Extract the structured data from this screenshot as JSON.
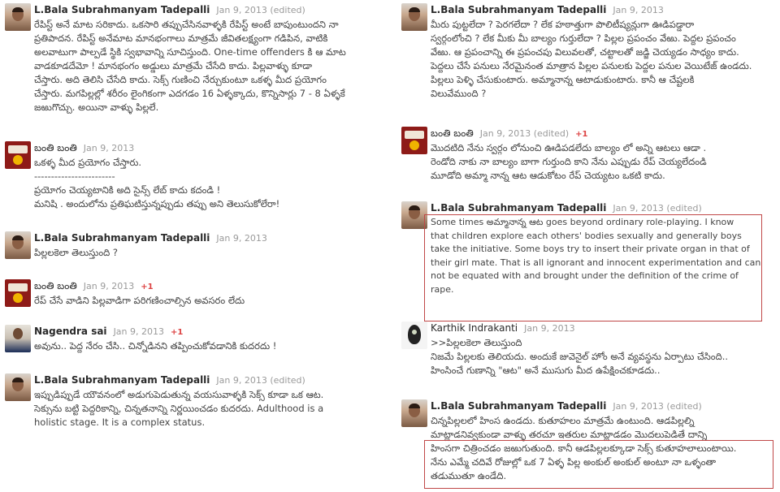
{
  "left": [
    {
      "author": "L.Bala Subrahmanyam Tadepalli",
      "date": "Jan 9, 2013 (edited)",
      "plus": "",
      "avatar": "bala",
      "lines": [
        "రేపిస్ట్ అనే మాట సరికాదు. ఒకసారి తప్పుచేసినవాళ్ళకి రేపిస్ట్ అంటే బాపుంటుందని నా",
        "ప్రతిపాదన. రేపిస్ట్ అనేమాట మానభంగాలు మాత్రమే జీవితలక్ష్యంగా గడిపిన, వాటికి",
        "అలవాటుగా పాల్పడే స్థికి స్వభావాన్ని సూచిస్తుంది. One-time offenders కి ఆ మాట",
        "వాడకూడదేమో ! మానభంగం అడ్డులు మాత్రమే చేసేది కాదు. పిల్లవాళ్ళు కూడా",
        "చేస్తారు. అది తెలిసి చేసేది కాదు. సెక్స్ గుణించి నేర్చుకుంటూ ఒకళ్ళ మీద ప్రయోగం",
        "చేస్తారు. మగపిల్లల్లో శరీరం లైంగికంగా ఎదగడం 16 ఏళ్ళక్కాదు, కొన్నిసార్లు 7 - 8 ఏళ్ళకే",
        "జఱుగొచ్చు. అయినా వాళ్ళు పిల్లలే."
      ]
    },
    {
      "author": "బంతి బంతి",
      "date": "Jan 9, 2013",
      "plus": "",
      "avatar": "banti",
      "lines": [
        "ఒకళ్ళ మీద ప్రయోగం చేస్తారు.",
        "------------------------",
        "ప్రయోగం చెయ్యటానికి అది సైన్స్ లేబ్ కాదు కదండి !",
        "మనిషి . అందులోను ప్రతిఘటిస్తున్నప్పుడు తప్పు అని తెలుసుకోలేరా!"
      ]
    },
    {
      "author": "L.Bala Subrahmanyam Tadepalli",
      "date": "Jan 9, 2013",
      "plus": "",
      "avatar": "bala",
      "lines": [
        "పిల్లలకెలా తెలుస్తుంది ?"
      ]
    },
    {
      "author": "బంతి బంతి",
      "date": "Jan 9, 2013",
      "plus": "+1",
      "avatar": "banti",
      "lines": [
        "రేప్ చేసే వాడిని పిల్లవాడిగా పరిగణించాల్సిన అవసరం లేదు"
      ]
    },
    {
      "author": "Nagendra sai",
      "date": "Jan 9, 2013",
      "plus": "+1",
      "avatar": "nag",
      "lines": [
        "అవును.. పెద్ద నేరం చేసి.. చిన్నోడినని తప్పించుకోవడానికి కుదరదు !"
      ]
    },
    {
      "author": "L.Bala Subrahmanyam Tadepalli",
      "date": "Jan 9, 2013 (edited)",
      "plus": "",
      "avatar": "bala",
      "lines": [
        "ఇప్పుడిప్పుడే యౌవనంలో అడుగుపెడుతున్న వయసువాళ్ళకి సెక్స్ కూడా ఒక ఆట.",
        "సెక్సును బట్టి పెద్దరికాన్ని, చిన్నతనాన్ని నిర్ణయించడం కుదరదు. Adulthood is a",
        "holistic stage. It is a complex status."
      ]
    }
  ],
  "right": [
    {
      "author": "L.Bala Subrahmanyam Tadepalli",
      "date": "Jan 9, 2013",
      "plus": "",
      "avatar": "bala",
      "lines": [
        "మీరు పుట్టలేదా ? పెరగలేదా ? లేక హఠాత్తుగా పొలిటీష్యన్లుగా ఊడిపడ్డారా",
        "స్వర్గంలోంచి ? లేక మీకు మీ బాల్యం గుర్తులేదా ? పిల్లల ప్రపంచం వేఱు. పెద్దల ప్రపంచం",
        "వేఱు. ఆ ప్రపంచాన్ని ఈ ప్రపంచపు విలువలతో, చట్టాలతో జడ్జి చెయ్యడం సాధ్యం కాదు.",
        "పెద్దలు చేసే పనులు నేరమైనంత మాత్రాన పిల్లల పనులకు పెద్దల పనుల వెయిటేజ్ ఉండదు.",
        "పిల్లలు పెళ్ళి చేసుకుంటారు. అమ్మానాన్న ఆటాడుకుంటారు. కానీ ఆ చేష్టలకి",
        "విలువేముంది ?"
      ]
    },
    {
      "author": "బంతి బంతి",
      "date": "Jan 9, 2013 (edited)",
      "plus": "+1",
      "avatar": "banti",
      "lines": [
        "మొదటిది నేను స్వర్గం లోనుంచి ఊడిపడలేదు బాల్యం లో అన్ని ఆటలు ఆడా .",
        "రెండోది నాకు నా బాల్యం బాగా గుర్తుంది కాని నేను ఎప్పుడు రేప్ చెయ్యలేదండి",
        "మూడోది అమ్మా నాన్న ఆట ఆడుకోటం రేప్ చెయ్యటం ఒకటి కాదు."
      ]
    },
    {
      "author": "L.Bala Subrahmanyam Tadepalli",
      "date": "Jan 9, 2013 (edited)",
      "plus": "",
      "avatar": "bala",
      "lines": [
        "Some times అమ్మానాన్న ఆట goes beyond ordinary role-playing. I know",
        "that children explore each others' bodies sexually and generally boys",
        "take the initiative. Some boys try to insert their private organ in that of",
        "their girl mate. That is all ignorant and innocent experimentation and can",
        "not be equated with and brought under the definition of the crime of",
        "rape."
      ]
    },
    {
      "author": "Karthik Indrakanti",
      "date": "Jan 9, 2013",
      "plus": "",
      "avatar": "kar",
      "lines": [
        ">>పిల్లలకెలా తెలుస్తుంది",
        "నిజమే పిల్లలకు తెలియదు. అందుకే జువెనైల్ హోం అనే వ్యవస్థను ఏర్పాటు చేసింది..",
        "హింసించే గుణాన్ని \"ఆట\" అనే ముసుగు మీద ఉపేక్షించకూడదు.."
      ]
    },
    {
      "author": "L.Bala Subrahmanyam Tadepalli",
      "date": "Jan 9, 2013 (edited)",
      "plus": "",
      "avatar": "bala",
      "lines": [
        "చిన్నపిల్లలలో హింస ఉండదు. కుతూహలం మాత్రమే ఉంటుంది. ఆడపిల్లల్ని",
        "మాట్లాడనివ్వకుండా వాళ్ళు తరచూ ఇతరుల మాట్లాడడం మొదలుపెడితే దాన్ని",
        "హింసగా చిత్రించడం జఱుగుతుంది. కానీ ఆడపిల్లలక్కూడా సెక్స్ కుతూహలాలుంటాయి.",
        "నేను ఎమ్మే చదివే రోజుల్లో ఒక 7 ఏళ్ళ పిల్ల అంకుల్ అంకుల్ అంటూ నా ఒళ్ళంతా",
        "తడుముతూ ఉండేది."
      ]
    }
  ]
}
